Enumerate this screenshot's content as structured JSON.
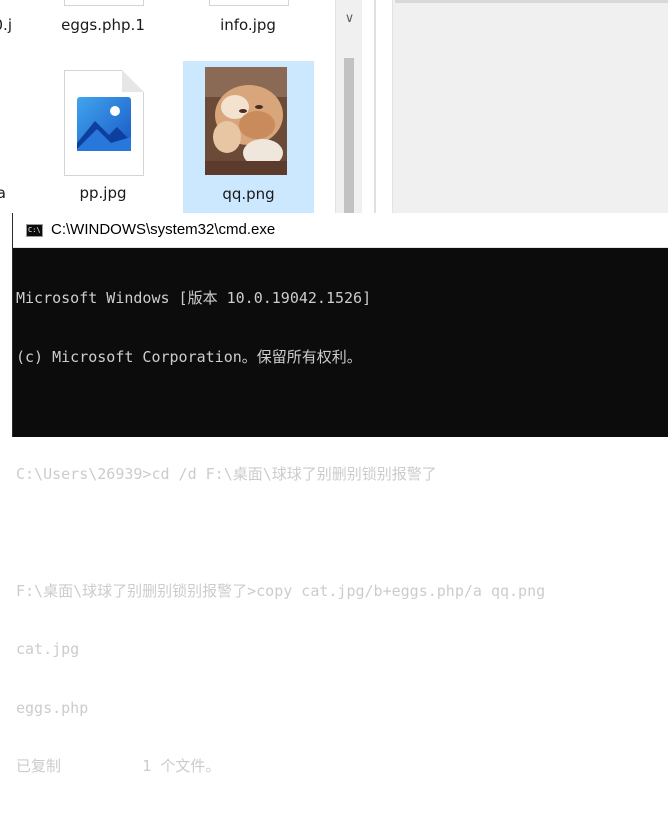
{
  "explorer": {
    "top_row": [
      {
        "label": "0.j"
      },
      {
        "label": "eggs.php.1"
      },
      {
        "label": "info.jpg"
      }
    ],
    "files": [
      {
        "label": "a",
        "icon": "partial-file-icon"
      },
      {
        "label": "pp.jpg",
        "icon": "image-file-icon"
      },
      {
        "label": "qq.png",
        "icon": "cat-thumbnail",
        "selected": true
      }
    ],
    "scrollbar": {
      "down_arrow": "∨"
    }
  },
  "cmd": {
    "title": "C:\\WINDOWS\\system32\\cmd.exe",
    "icon_text": "C:\\",
    "lines": [
      "Microsoft Windows [版本 10.0.19042.1526]",
      "(c) Microsoft Corporation。保留所有权利。",
      "",
      "C:\\Users\\26939>cd /d F:\\桌面\\球球了别删别锁别报警了",
      "",
      "F:\\桌面\\球球了别删别锁别报警了>copy cat.jpg/b+eggs.php/a qq.png",
      "cat.jpg",
      "eggs.php",
      "已复制         1 个文件。"
    ]
  },
  "colors": {
    "selection": "#cce8ff",
    "console_bg": "#0c0c0c",
    "console_text": "#cccccc",
    "image_icon_blue": "#1e6fd9"
  }
}
